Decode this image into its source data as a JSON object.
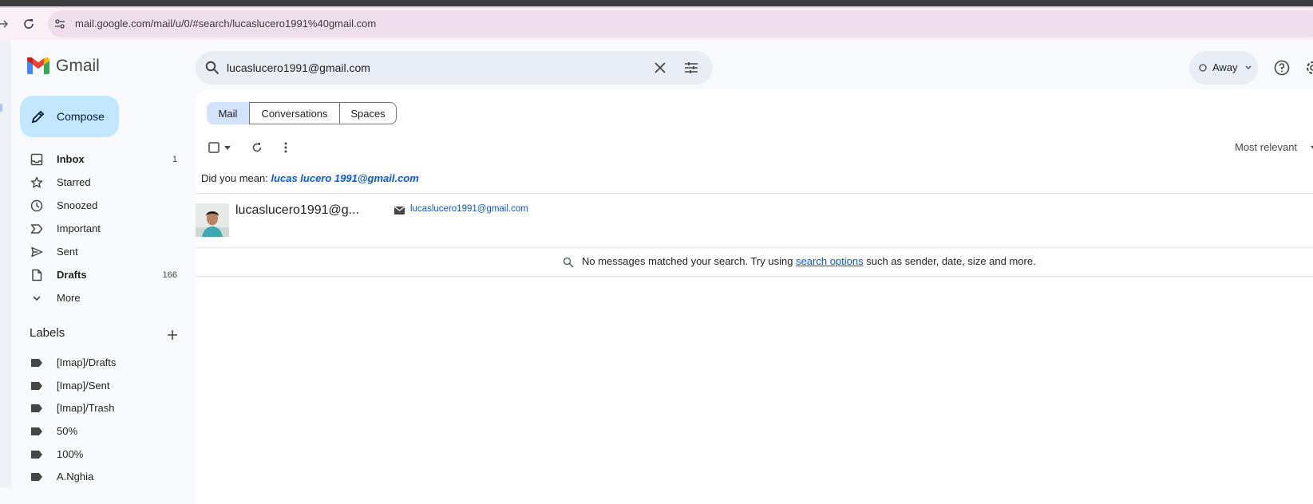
{
  "browser": {
    "url": "mail.google.com/mail/u/0/#search/lucaslucero1991%40gmail.com"
  },
  "app": {
    "name": "Gmail"
  },
  "search": {
    "query": "lucaslucero1991@gmail.com"
  },
  "status": {
    "label": "Away"
  },
  "compose": {
    "label": "Compose"
  },
  "nav": [
    {
      "label": "Inbox",
      "count": "1",
      "bold": true,
      "icon": "inbox-icon"
    },
    {
      "label": "Starred",
      "count": "",
      "bold": false,
      "icon": "star-icon"
    },
    {
      "label": "Snoozed",
      "count": "",
      "bold": false,
      "icon": "clock-icon"
    },
    {
      "label": "Important",
      "count": "",
      "bold": false,
      "icon": "important-icon"
    },
    {
      "label": "Sent",
      "count": "",
      "bold": false,
      "icon": "send-icon"
    },
    {
      "label": "Drafts",
      "count": "166",
      "bold": true,
      "icon": "draft-icon"
    },
    {
      "label": "More",
      "count": "",
      "bold": false,
      "icon": "chevron-down-icon"
    }
  ],
  "labels": {
    "heading": "Labels",
    "items": [
      "[Imap]/Drafts",
      "[Imap]/Sent",
      "[Imap]/Trash",
      "50%",
      "100%",
      "A.Nghia"
    ]
  },
  "tabs": [
    "Mail",
    "Conversations",
    "Spaces"
  ],
  "sort": {
    "label": "Most relevant"
  },
  "suggestion": {
    "prefix": "Did you mean: ",
    "text": "lucas lucero 1991@gmail.com"
  },
  "contact": {
    "name": "lucaslucero1991@g...",
    "email": "lucaslucero1991@gmail.com"
  },
  "empty": {
    "before": "No messages matched your search. Try using ",
    "link": "search options",
    "after": " such as sender, date, size and more."
  },
  "colors": {
    "accent": "#0b57d0",
    "compose_bg": "#c2e7ff",
    "selected_tab": "#d3e3fd",
    "page_bg": "#f8fafd"
  }
}
